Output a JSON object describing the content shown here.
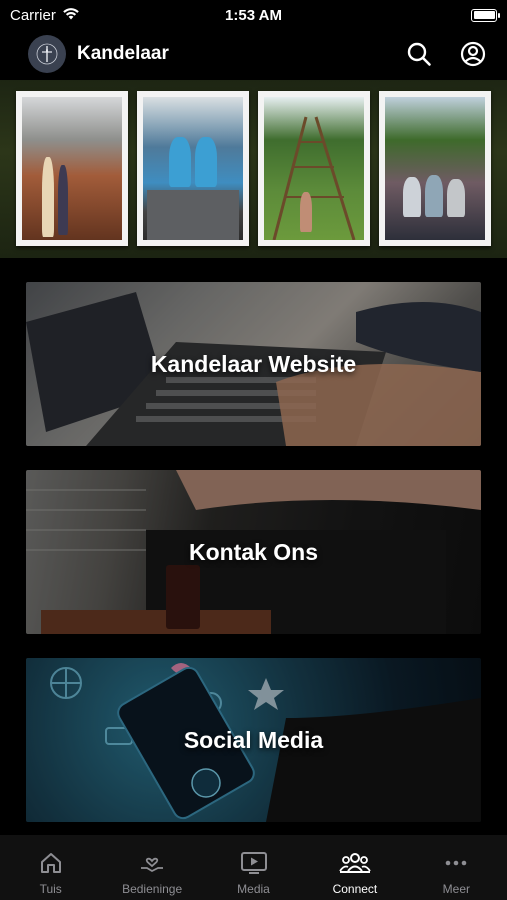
{
  "status_bar": {
    "carrier": "Carrier",
    "time": "1:53 AM"
  },
  "header": {
    "title": "Kandelaar"
  },
  "tiles": [
    {
      "label": "Kandelaar Website"
    },
    {
      "label": "Kontak Ons"
    },
    {
      "label": "Social Media"
    }
  ],
  "tab_bar": {
    "active": "Connect",
    "tabs": [
      {
        "label": "Tuis",
        "icon": "home-icon"
      },
      {
        "label": "Bedieninge",
        "icon": "hands-heart-icon"
      },
      {
        "label": "Media",
        "icon": "play-screen-icon"
      },
      {
        "label": "Connect",
        "icon": "people-icon"
      },
      {
        "label": "Meer",
        "icon": "more-icon"
      }
    ]
  },
  "colors": {
    "background": "#000000",
    "tab_bar": "#111111",
    "tab_inactive": "#8e8e93",
    "tab_active": "#ffffff"
  }
}
